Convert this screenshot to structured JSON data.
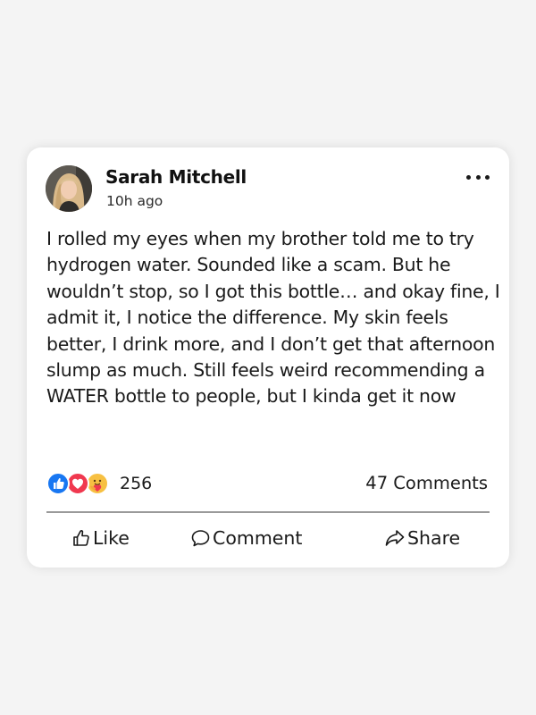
{
  "post": {
    "author": "Sarah Mitchell",
    "time": "10h ago",
    "text": "I rolled my eyes when my brother told me to try hydrogen water. Sounded like a scam. But he wouldn’t stop, so I got this bottle… and okay fine, I admit it, I notice the difference. My skin feels better, I drink more, and I don’t get that afternoon slump as much. Still feels weird recommending a WATER bottle to people, but I kinda get it now",
    "more_icon": "ellipsis-icon"
  },
  "reactions": {
    "icons": [
      "like-reaction-icon",
      "love-reaction-icon",
      "care-reaction-icon"
    ],
    "count": "256"
  },
  "comments": {
    "count_label": "47 Comments"
  },
  "actions": {
    "like_label": "Like",
    "comment_label": "Comment",
    "share_label": "Share"
  },
  "colors": {
    "background": "#f4f4f4",
    "card": "#ffffff",
    "like_blue": "#1877f2",
    "love_red": "#f0384f",
    "care_yellow": "#f7c042",
    "divider": "#9a9a9a"
  }
}
